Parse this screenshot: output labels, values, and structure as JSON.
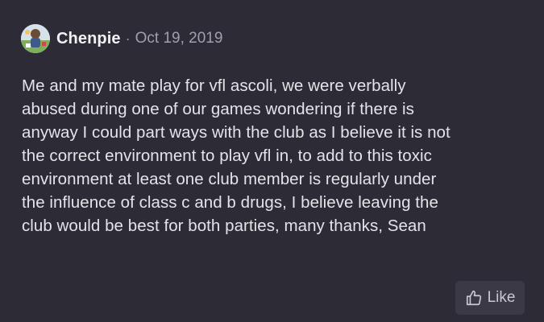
{
  "post": {
    "author": "Chenpie",
    "separator": "·",
    "date": "Oct 19, 2019",
    "avatar_icon": "user-avatar-icon",
    "body": "Me and my mate play for vfl ascoli, we were verbally\nabused during one of our games wondering if there is\nanyway I could part ways with the club as I believe it is not\nthe correct environment to play vfl in, to add to this toxic\nenvironment at least one club member is regularly under\nthe influence of class c and b drugs, I believe leaving the\nclub would be best for both parties, many thanks, Sean",
    "like_label": "Like",
    "like_icon": "thumbs-up-icon"
  },
  "colors": {
    "background": "#2d2c36",
    "text": "#e4e3e8",
    "muted": "#a09fac",
    "button_bg": "#3a3945"
  }
}
